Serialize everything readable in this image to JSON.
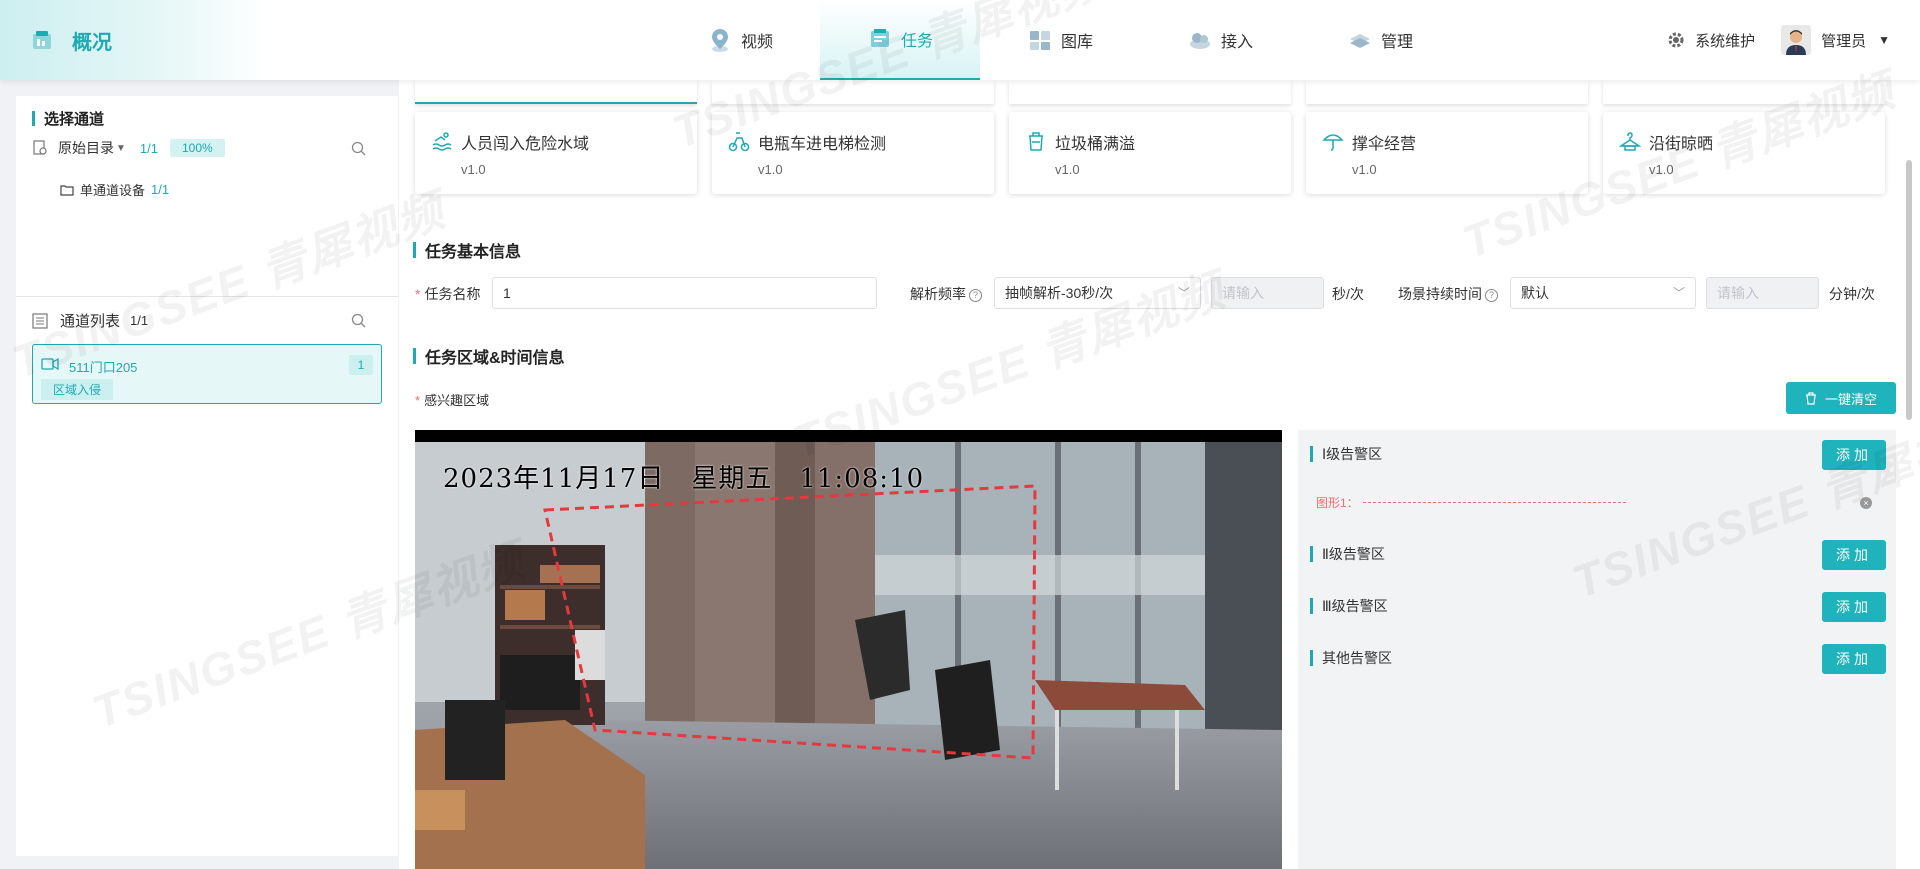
{
  "app": {
    "title": "概况"
  },
  "nav": [
    {
      "label": "视频",
      "icon": "map-pin-icon",
      "active": false
    },
    {
      "label": "任务",
      "icon": "task-icon",
      "active": true
    },
    {
      "label": "图库",
      "icon": "gallery-icon",
      "active": false
    },
    {
      "label": "接入",
      "icon": "access-icon",
      "active": false
    },
    {
      "label": "管理",
      "icon": "manage-icon",
      "active": false
    }
  ],
  "header": {
    "system_label": "系统维护",
    "user_label": "管理员"
  },
  "channel_select": {
    "title": "选择通道",
    "root_label": "原始目录",
    "root_count": "1/1",
    "root_percent": "100%",
    "device_label": "单通道设备",
    "device_count": "1/1"
  },
  "channel_list": {
    "title": "通道列表",
    "count": "1/1",
    "items": [
      {
        "name": "511门口205",
        "tag": "区域入侵",
        "badge": "1"
      }
    ]
  },
  "algorithms": [
    {
      "name": "人员闯入危险水域",
      "version": "v1.0",
      "icon": "swimmer-icon"
    },
    {
      "name": "电瓶车进电梯检测",
      "version": "v1.0",
      "icon": "ebike-icon"
    },
    {
      "name": "垃圾桶满溢",
      "version": "v1.0",
      "icon": "trash-bin-icon"
    },
    {
      "name": "撑伞经营",
      "version": "v1.0",
      "icon": "umbrella-icon"
    },
    {
      "name": "沿街晾晒",
      "version": "v1.0",
      "icon": "hanger-icon"
    }
  ],
  "task_info": {
    "title": "任务基本信息",
    "name_label": "任务名称",
    "name_value": "1",
    "freq_label": "解析频率",
    "freq_value": "抽帧解析-30秒/次",
    "freq_input_placeholder": "请输入",
    "freq_unit": "秒/次",
    "duration_label": "场景持续时间",
    "duration_value": "默认",
    "duration_input_placeholder": "请输入",
    "duration_unit": "分钟/次"
  },
  "region_info": {
    "title": "任务区域&时间信息",
    "roi_label": "感兴趣区域",
    "clear_label": "一键清空",
    "video_timestamp": "2023年11月17日　星期五　11:08:10"
  },
  "zones": [
    {
      "label": "Ⅰ级告警区",
      "add_label": "添加",
      "shapes": [
        {
          "label": "图形1："
        }
      ]
    },
    {
      "label": "Ⅱ级告警区",
      "add_label": "添加",
      "shapes": []
    },
    {
      "label": "Ⅲ级告警区",
      "add_label": "添加",
      "shapes": []
    },
    {
      "label": "其他告警区",
      "add_label": "添加",
      "shapes": []
    }
  ],
  "watermark": "TSINGSEE 青犀视频",
  "colors": {
    "accent": "#1fa9b2",
    "button": "#1fb3bb",
    "danger": "#f56c6c"
  }
}
